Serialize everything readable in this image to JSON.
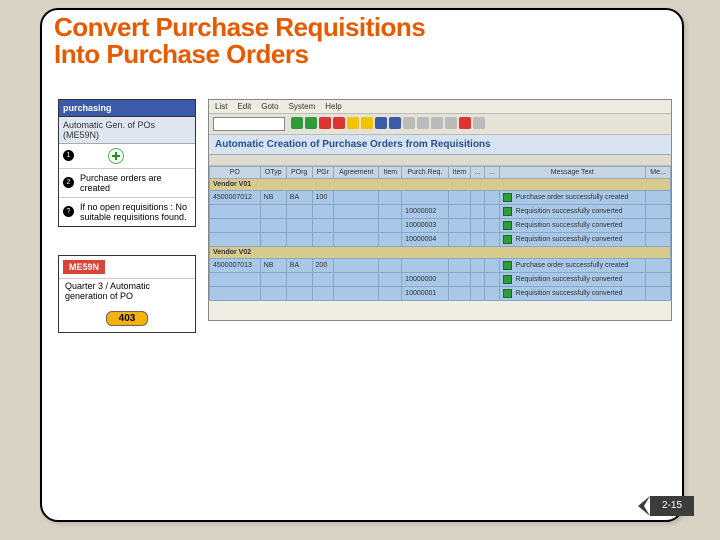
{
  "title_line1": "Convert Purchase Requisitions",
  "title_line2": "Into Purchase Orders",
  "leftCard1": {
    "header": "purchasing",
    "sub": "Automatic Gen. of POs (ME59N)",
    "rows": [
      {
        "num": "1",
        "text": ""
      },
      {
        "num": "2",
        "text": "Purchase orders are created"
      },
      {
        "num": "?",
        "text": "If no open requisitions : No suitable requisitions found."
      }
    ]
  },
  "leftCard2": {
    "tag": "ME59N",
    "desc": "Quarter 3 / Automatic generation of PO",
    "page": "403"
  },
  "sap": {
    "menu": [
      "List",
      "Edit",
      "Goto",
      "System",
      "Help"
    ],
    "title": "Automatic Creation of Purchase Orders from Requisitions",
    "columns": [
      "PO",
      "OTyp",
      "POrg",
      "PGr",
      "Agreement",
      "Item",
      "Purch.Req.",
      "Item",
      "...",
      "...",
      "Message Text",
      "Me..."
    ],
    "groups": [
      {
        "vendor": "Vendor V01",
        "rows": [
          {
            "po": "4500007012",
            "otyp": "NB",
            "porg": "BA",
            "pgr": "100",
            "agr": "",
            "it": "",
            "req": "",
            "ri": "",
            "m": "Purchase order successfully created",
            "icon": "b"
          },
          {
            "po": "",
            "otyp": "",
            "porg": "",
            "pgr": "",
            "agr": "",
            "it": "",
            "req": "10000002",
            "ri": "",
            "m": "Requisition successfully converted",
            "icon": "g"
          },
          {
            "po": "",
            "otyp": "",
            "porg": "",
            "pgr": "",
            "agr": "",
            "it": "",
            "req": "10000003",
            "ri": "",
            "m": "Requisition successfully converted",
            "icon": "g"
          },
          {
            "po": "",
            "otyp": "",
            "porg": "",
            "pgr": "",
            "agr": "",
            "it": "",
            "req": "10000004",
            "ri": "",
            "m": "Requisition successfully converted",
            "icon": "g"
          }
        ]
      },
      {
        "vendor": "Vendor V02",
        "rows": [
          {
            "po": "4500007013",
            "otyp": "NB",
            "porg": "BA",
            "pgr": "200",
            "agr": "",
            "it": "",
            "req": "",
            "ri": "",
            "m": "Purchase order successfully created",
            "icon": "b"
          },
          {
            "po": "",
            "otyp": "",
            "porg": "",
            "pgr": "",
            "agr": "",
            "it": "",
            "req": "10000000",
            "ri": "",
            "m": "Requisition successfully converted",
            "icon": "g"
          },
          {
            "po": "",
            "otyp": "",
            "porg": "",
            "pgr": "",
            "agr": "",
            "it": "",
            "req": "10000001",
            "ri": "",
            "m": "Requisition successfully converted",
            "icon": "g"
          }
        ]
      }
    ],
    "toolbar_colors": [
      "#2e9c3a",
      "#2e9c3a",
      "#d33",
      "#d33",
      "#f2c300",
      "#f2c300",
      "#3b5ba8",
      "#3b5ba8",
      "#bbb",
      "#bbb",
      "#bbb",
      "#bbb",
      "#d33",
      "#bbb"
    ]
  },
  "page_number": "2-15"
}
